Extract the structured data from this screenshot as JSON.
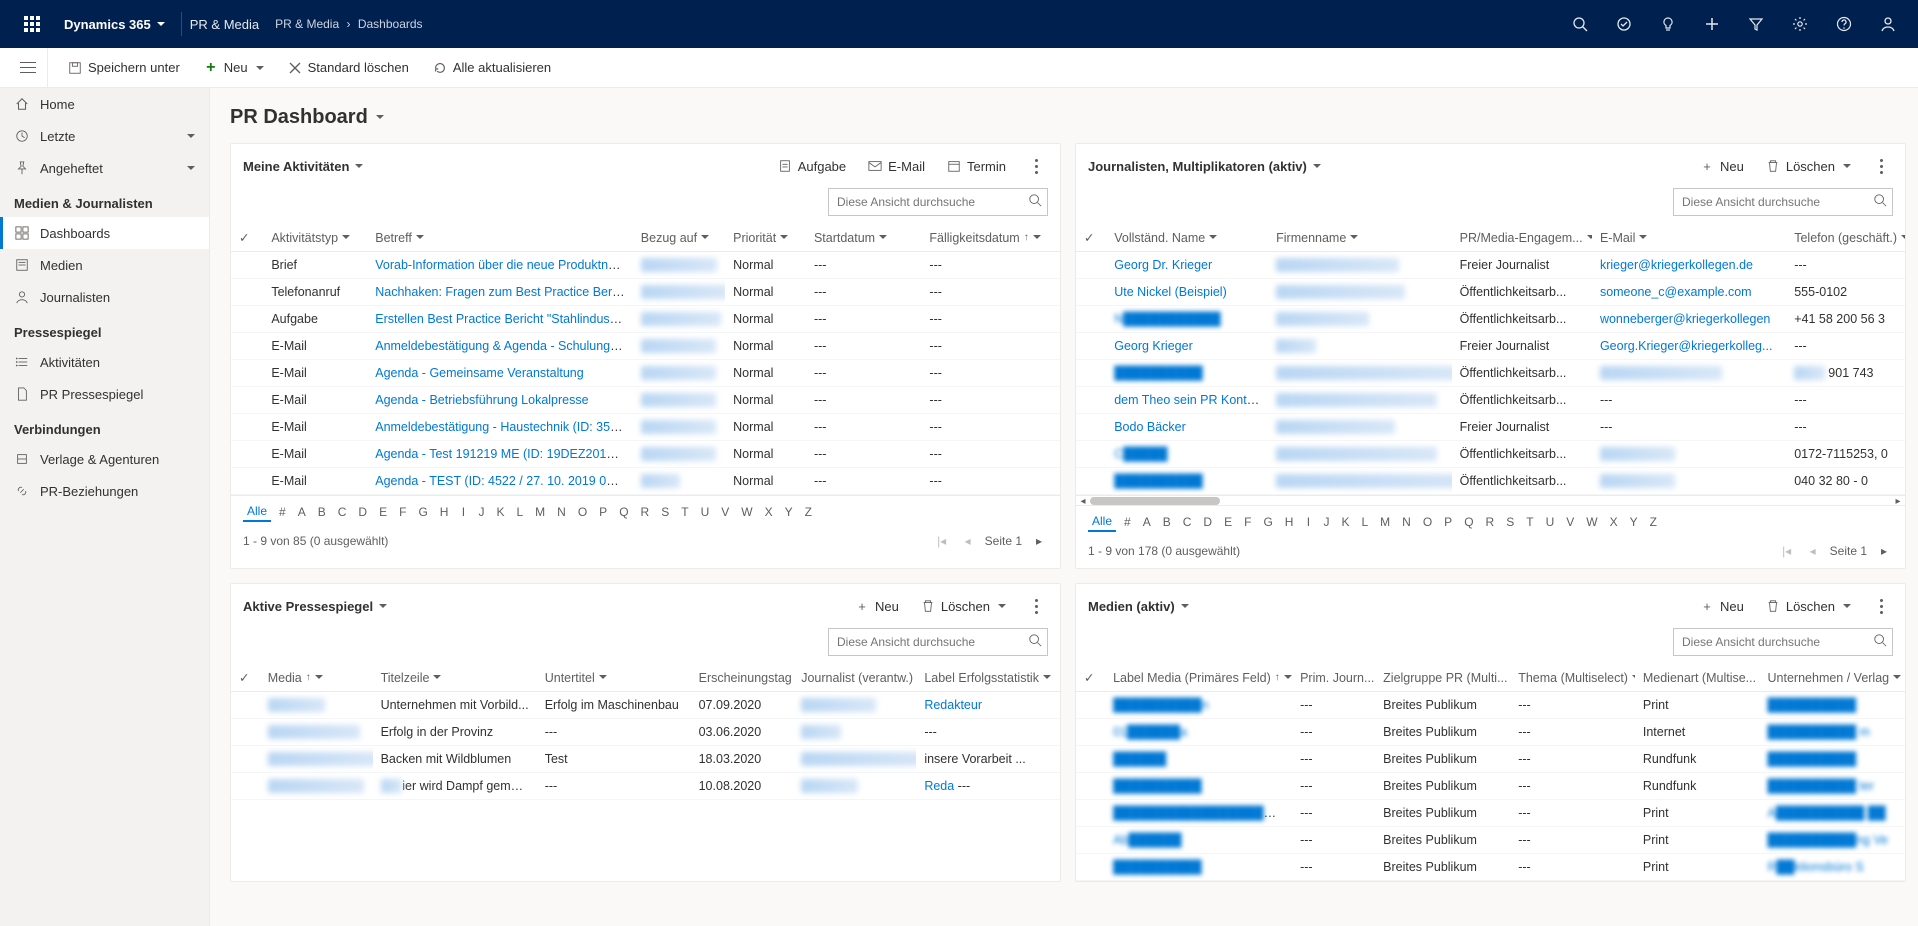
{
  "topbar": {
    "product": "Dynamics 365",
    "app_area": "PR & Media",
    "breadcrumbs": [
      "PR & Media",
      "Dashboards"
    ]
  },
  "commandbar": {
    "save_as": "Speichern unter",
    "new": "Neu",
    "delete_default": "Standard löschen",
    "refresh_all": "Alle aktualisieren"
  },
  "sidebar": {
    "basic": [
      {
        "icon": "home",
        "label": "Home"
      },
      {
        "icon": "clock",
        "label": "Letzte",
        "hasChevron": true
      },
      {
        "icon": "pin",
        "label": "Angeheftet",
        "hasChevron": true
      }
    ],
    "groups": [
      {
        "title": "Medien & Journalisten",
        "items": [
          {
            "icon": "dashboard",
            "label": "Dashboards",
            "active": true
          },
          {
            "icon": "news",
            "label": "Medien"
          },
          {
            "icon": "person",
            "label": "Journalisten"
          }
        ]
      },
      {
        "title": "Pressespiegel",
        "items": [
          {
            "icon": "list",
            "label": "Aktivitäten"
          },
          {
            "icon": "doc",
            "label": "PR Pressespiegel"
          }
        ]
      },
      {
        "title": "Verbindungen",
        "items": [
          {
            "icon": "org",
            "label": "Verlage & Agenturen"
          },
          {
            "icon": "link",
            "label": "PR-Beziehungen"
          }
        ]
      }
    ]
  },
  "page": {
    "title": "PR Dashboard"
  },
  "panels": {
    "activities": {
      "title": "Meine Aktivitäten",
      "actions": {
        "task": "Aufgabe",
        "email": "E-Mail",
        "appointment": "Termin"
      },
      "search_ph": "Diese Ansicht durchsuche",
      "columns": [
        "Aktivitätstyp",
        "Betreff",
        "Bezug auf",
        "Priorität",
        "Startdatum",
        "Fälligkeitsdatum"
      ],
      "rows": [
        {
          "type": "Brief",
          "subject": "Vorab-Information über die neue Produktneuheit",
          "ref": "M███████",
          "ref_blur": true,
          "prio": "Normal",
          "start": "---",
          "due": "---"
        },
        {
          "type": "Telefonanruf",
          "subject": "Nachhaken: Fragen zum Best Practice Bericht",
          "ref": "█████████.",
          "ref_blur": true,
          "prio": "Normal",
          "start": "---",
          "due": "---"
        },
        {
          "type": "Aufgabe",
          "subject": "Erstellen Best Practice Bericht \"Stahlindustrie\"",
          "ref": "██ Schneller.",
          "ref_blur": true,
          "prio": "Normal",
          "start": "---",
          "due": "---"
        },
        {
          "type": "E-Mail",
          "subject": "Anmeldebestätigung & Agenda  - Schulung Heiz",
          "ref": "████████",
          "ref_blur": true,
          "prio": "Normal",
          "start": "---",
          "due": "---"
        },
        {
          "type": "E-Mail",
          "subject": "Agenda - Gemeinsame Veranstaltung",
          "ref": "████████",
          "ref_blur": true,
          "prio": "Normal",
          "start": "---",
          "due": "---"
        },
        {
          "type": "E-Mail",
          "subject": "Agenda - Betriebsführung Lokalpresse",
          "ref": "████████",
          "ref_blur": true,
          "prio": "Normal",
          "start": "---",
          "due": "---"
        },
        {
          "type": "E-Mail",
          "subject": "Anmeldebestätigung - Haustechnik (ID: 358 / 06.",
          "ref": "████████",
          "ref_blur": true,
          "prio": "Normal",
          "start": "---",
          "due": "---"
        },
        {
          "type": "E-Mail",
          "subject": "Agenda - Test 191219 ME (ID: 19DEZ2019 / 03. 0.",
          "ref": "████████",
          "ref_blur": true,
          "prio": "Normal",
          "start": "---",
          "due": "---"
        },
        {
          "type": "E-Mail",
          "subject": "Agenda - TEST (ID: 4522 / 27. 10. 2019 08:00 Uhr",
          "ref": "████",
          "ref_blur": true,
          "prio": "Normal",
          "start": "---",
          "due": "---"
        }
      ],
      "status": "1 - 9 von 85 (0 ausgewählt)",
      "page_label": "Seite 1"
    },
    "journalists": {
      "title": "Journalisten, Multiplikatoren (aktiv)",
      "actions": {
        "new": "Neu",
        "delete": "Löschen"
      },
      "search_ph": "Diese Ansicht durchsuche",
      "columns": [
        "Vollständ. Name",
        "Firmenname",
        "PR/Media-Engagem...",
        "E-Mail",
        "Telefon (geschäft.)"
      ],
      "rows": [
        {
          "name": "Georg Dr. Krieger",
          "firm": "████████████ H",
          "firm_blur": true,
          "eng": "Freier Journalist",
          "email": "krieger@kriegerkollegen.de",
          "tel": "---"
        },
        {
          "name": "Ute Nickel (Beispiel)",
          "firm": "████ture   ████ ██!)",
          "firm_blur": true,
          "eng": "Öffentlichkeitsarb...",
          "email": "someone_c@example.com",
          "tel": "555-0102"
        },
        {
          "name": "N███████████",
          "name_blur": true,
          "firm": "██████████",
          "firm_blur": true,
          "eng": "Öffentlichkeitsarb...",
          "email": "wonneberger@kriegerkollegen",
          "tel": "+41 58 200 56 3"
        },
        {
          "name": "Georg Krieger",
          "firm": "████",
          "firm_blur": true,
          "eng": "Freier Journalist",
          "email": "Georg.Krieger@kriegerkolleg...",
          "tel": "---"
        },
        {
          "name": "██████████",
          "name_blur": true,
          "firm": "██████████ g. ████████",
          "firm_blur": true,
          "eng": "Öffentlichkeitsarb...",
          "email": "████████geblatt.c",
          "email_blur": true,
          "tel": "901 743",
          "tel_prefix_blur": true
        },
        {
          "name": "dem Theo sein PR Kontakt",
          "firm": "██SO   ██SITA██ET GmbH",
          "firm_blur": true,
          "eng": "Öffentlichkeitsarb...",
          "email": "---",
          "tel": "---"
        },
        {
          "name": "Bodo Bäcker",
          "firm": "█████████████",
          "firm_blur": true,
          "eng": "Freier Journalist",
          "email": "---",
          "tel": "---"
        },
        {
          "name": "C█████",
          "name_blur": true,
          "firm": "████ites ██████rnsehen",
          "firm_blur": true,
          "eng": "Öffentlichkeitsarb...",
          "email": "████████",
          "email_blur": true,
          "tel": "0172-7115253, 0"
        },
        {
          "name": "██████████",
          "name_blur": true,
          "firm": "████████████ GmbH & Co. KG",
          "firm_blur": true,
          "eng": "Öffentlichkeitsarb...",
          "email": "████████",
          "email_blur": true,
          "tel": "040 32 80 - 0"
        }
      ],
      "status": "1 - 9 von 178 (0 ausgewählt)",
      "page_label": "Seite 1"
    },
    "clippings": {
      "title": "Aktive Pressespiegel",
      "actions": {
        "new": "Neu",
        "delete": "Löschen"
      },
      "search_ph": "Diese Ansicht durchsuche",
      "columns": [
        "Media",
        "Titelzeile",
        "Untertitel",
        "Erscheinungstag",
        "Journalist (verantw.)",
        "Label Erfolgsstatistik"
      ],
      "rows": [
        {
          "media": "██████",
          "media_blur": true,
          "title": "Unternehmen mit Vorbild...",
          "subtitle": "Erfolg im Maschinenbau",
          "date": "07.09.2020",
          "j": "████████",
          "j_blur": true,
          "label": "Redakteur",
          "label_link": true
        },
        {
          "media": "██████████",
          "media_blur": true,
          "title": "Erfolg in der Provinz",
          "subtitle": "---",
          "date": "03.06.2020",
          "j": "████",
          "j_blur": true,
          "label": "---"
        },
        {
          "media": "████████████",
          "media_blur": true,
          "title": "Backen mit Wildblumen",
          "subtitle": "Test",
          "date": "18.03.2020",
          "j": "██████████████",
          "j_blur": true,
          "label": "insere Vorarbeit ..."
        },
        {
          "media": "r██████████",
          "media_blur": true,
          "title": "██ier wird Dampf gemacht",
          "title_partial_blur": true,
          "subtitle": "---",
          "date": "10.08.2020",
          "j": "██████",
          "j_blur": true,
          "label": "Reda",
          "label_link": true,
          "label2": "---"
        }
      ]
    },
    "media": {
      "title": "Medien (aktiv)",
      "actions": {
        "new": "Neu",
        "delete": "Löschen"
      },
      "search_ph": "Diese Ansicht durchsuche",
      "columns": [
        "Label Media (Primäres Feld)",
        "Prim. Journ...",
        "Zielgruppe PR (Multi...",
        "Thema (Multiselect)",
        "Medienart (Multise...",
        "Unternehmen / Verlag"
      ],
      "rows": [
        {
          "label": "██████████n",
          "label_blur": true,
          "pj": "---",
          "zg": "Breites Publikum",
          "thema": "---",
          "art": "Print",
          "firm": "██████████",
          "firm_blur": true
        },
        {
          "label": "01██████a",
          "label_blur": true,
          "pj": "---",
          "zg": "Breites Publikum",
          "thema": "---",
          "art": "Internet",
          "firm": "██████████ m",
          "firm_blur": true
        },
        {
          "label": "██████",
          "label_blur": true,
          "pj": "---",
          "zg": "Breites Publikum",
          "thema": "---",
          "art": "Rundfunk",
          "firm": "██████████",
          "firm_blur": true
        },
        {
          "label": "██████████",
          "label_blur": true,
          "pj": "---",
          "zg": "Breites Publikum",
          "thema": "---",
          "art": "Rundfunk",
          "firm": "██████████ ter",
          "firm_blur": true
        },
        {
          "label": "██████████████████ung",
          "label_blur": true,
          "pj": "---",
          "zg": "Breites Publikum",
          "thema": "---",
          "art": "Print",
          "firm": "A██████████ ██",
          "firm_blur": true
        },
        {
          "label": "Ab██████",
          "label_blur": true,
          "pj": "---",
          "zg": "Breites Publikum",
          "thema": "---",
          "art": "Print",
          "firm": "██████████ng Ve",
          "firm_blur": true
        },
        {
          "label": "██████████",
          "label_blur": true,
          "pj": "---",
          "zg": "Breites Publikum",
          "thema": "---",
          "art": "Print",
          "firm": "R██ktionsbüro S",
          "firm_blur": true
        }
      ]
    }
  },
  "alpha": [
    "Alle",
    "#",
    "A",
    "B",
    "C",
    "D",
    "E",
    "F",
    "G",
    "H",
    "I",
    "J",
    "K",
    "L",
    "M",
    "N",
    "O",
    "P",
    "Q",
    "R",
    "S",
    "T",
    "U",
    "V",
    "W",
    "X",
    "Y",
    "Z"
  ]
}
